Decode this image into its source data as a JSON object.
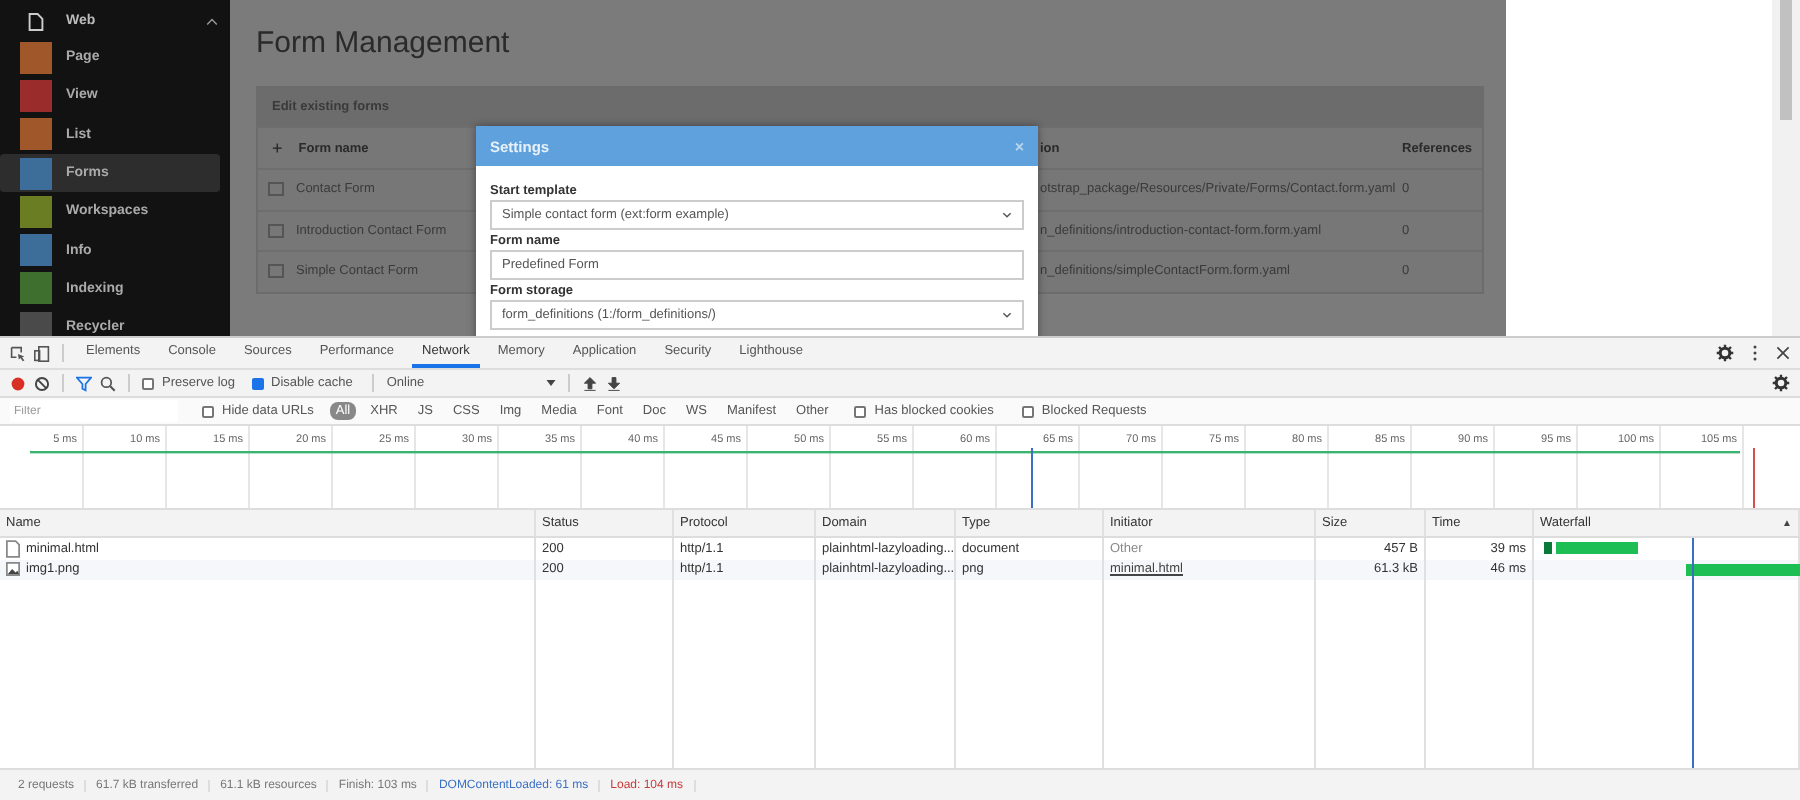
{
  "sidebar": {
    "group": {
      "label": "Web",
      "expanded": true
    },
    "items": [
      {
        "label": "Page",
        "color": "#a0582a",
        "selected": false
      },
      {
        "label": "View",
        "color": "#9a2c2c",
        "selected": false
      },
      {
        "label": "List",
        "color": "#a0582a",
        "selected": false
      },
      {
        "label": "Forms",
        "color": "#3d6e99",
        "selected": true
      },
      {
        "label": "Workspaces",
        "color": "#6a7d22",
        "selected": false
      },
      {
        "label": "Info",
        "color": "#3d6e99",
        "selected": false
      },
      {
        "label": "Indexing",
        "color": "#3f6f2f",
        "selected": false
      },
      {
        "label": "Recycler",
        "color": "#4a4a4a",
        "selected": false
      }
    ]
  },
  "page": {
    "title": "Form Management",
    "panel": {
      "title": "Edit existing forms",
      "add_button": "+",
      "columns": [
        "Form name",
        "ion",
        "References"
      ],
      "rows": [
        [
          "Contact Form",
          "otstrap_package/Resources/Private/Forms/Contact.form.yaml",
          "0"
        ],
        [
          "Introduction Contact Form",
          "n_definitions/introduction-contact-form.form.yaml",
          "0"
        ],
        [
          "Simple Contact Form",
          "n_definitions/simpleContactForm.form.yaml",
          "0"
        ]
      ]
    }
  },
  "dialog": {
    "title": "Settings",
    "close": "×",
    "fields": [
      {
        "label": "Start template",
        "kind": "select",
        "value": "Simple contact form (ext:form example)"
      },
      {
        "label": "Form name",
        "kind": "input",
        "value": "Predefined Form"
      },
      {
        "label": "Form storage",
        "kind": "select",
        "value": "form_definitions (1:/form_definitions/)"
      }
    ]
  },
  "devtools": {
    "tabs": [
      {
        "label": "Elements",
        "selected": false
      },
      {
        "label": "Console",
        "selected": false
      },
      {
        "label": "Sources",
        "selected": false
      },
      {
        "label": "Performance",
        "selected": false
      },
      {
        "label": "Network",
        "selected": true
      },
      {
        "label": "Memory",
        "selected": false
      },
      {
        "label": "Application",
        "selected": false
      },
      {
        "label": "Security",
        "selected": false
      },
      {
        "label": "Lighthouse",
        "selected": false
      }
    ],
    "toolbar": {
      "recording": true,
      "preserve_log": {
        "label": "Preserve log",
        "checked": false
      },
      "disable_cache": {
        "label": "Disable cache",
        "checked": true
      },
      "throttling": "Online"
    },
    "filter": {
      "placeholder": "Filter",
      "hide_data_urls": {
        "label": "Hide data URLs",
        "checked": false
      },
      "types": [
        {
          "label": "All",
          "selected": true
        },
        {
          "label": "XHR",
          "selected": false
        },
        {
          "label": "JS",
          "selected": false
        },
        {
          "label": "CSS",
          "selected": false
        },
        {
          "label": "Img",
          "selected": false
        },
        {
          "label": "Media",
          "selected": false
        },
        {
          "label": "Font",
          "selected": false
        },
        {
          "label": "Doc",
          "selected": false
        },
        {
          "label": "WS",
          "selected": false
        },
        {
          "label": "Manifest",
          "selected": false
        },
        {
          "label": "Other",
          "selected": false
        }
      ],
      "blocked_cookies": {
        "label": "Has blocked cookies",
        "checked": false
      },
      "blocked_requests": {
        "label": "Blocked Requests",
        "checked": false
      }
    },
    "timeline_ticks": [
      "5 ms",
      "10 ms",
      "15 ms",
      "20 ms",
      "25 ms",
      "30 ms",
      "35 ms",
      "40 ms",
      "45 ms",
      "50 ms",
      "55 ms",
      "60 ms",
      "65 ms",
      "70 ms",
      "75 ms",
      "80 ms",
      "85 ms",
      "90 ms",
      "95 ms",
      "100 ms",
      "105 ms"
    ],
    "columns": [
      "Name",
      "Status",
      "Protocol",
      "Domain",
      "Type",
      "Initiator",
      "Size",
      "Time",
      "Waterfall"
    ],
    "sort_indicator": "▲",
    "requests": [
      {
        "name": "minimal.html",
        "kind": "document",
        "status": "200",
        "protocol": "http/1.1",
        "domain": "plainhtml-lazyloading...",
        "type": "document",
        "initiator": "Other",
        "initiator_link": false,
        "size": "457 B",
        "time": "39 ms"
      },
      {
        "name": "img1.png",
        "kind": "image",
        "status": "200",
        "protocol": "http/1.1",
        "domain": "plainhtml-lazyloading...",
        "type": "png",
        "initiator": "minimal.html",
        "initiator_link": true,
        "size": "61.3 kB",
        "time": "46 ms"
      }
    ],
    "summary": [
      {
        "text": "2 requests",
        "color": "#777777"
      },
      {
        "text": "61.7 kB transferred",
        "color": "#777777"
      },
      {
        "text": "61.1 kB resources",
        "color": "#777777"
      },
      {
        "text": "Finish: 103 ms",
        "color": "#777777"
      },
      {
        "text": "DOMContentLoaded: 61 ms",
        "color": "#3a6fc4"
      },
      {
        "text": "Load: 104 ms",
        "color": "#c83a3a"
      }
    ]
  }
}
